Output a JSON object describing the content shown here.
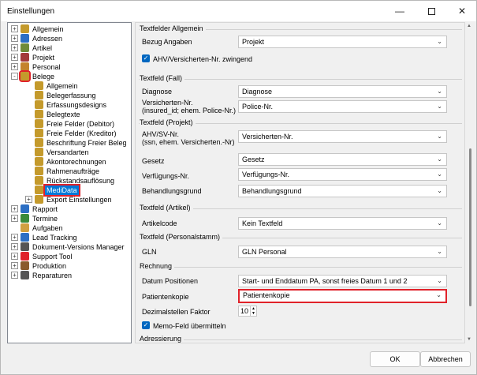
{
  "window": {
    "title": "Einstellungen"
  },
  "tree": {
    "items": [
      {
        "label": "Allgemein",
        "icon": "settings-folder-icon"
      },
      {
        "label": "Adressen",
        "icon": "address-book-icon"
      },
      {
        "label": "Artikel",
        "icon": "article-icon"
      },
      {
        "label": "Projekt",
        "icon": "project-icon"
      },
      {
        "label": "Personal",
        "icon": "personnel-icon"
      },
      {
        "label": "Belege",
        "icon": "documents-icon"
      },
      {
        "label": "Allgemein",
        "icon": "settings-icon"
      },
      {
        "label": "Belegerfassung",
        "icon": "settings-icon"
      },
      {
        "label": "Erfassungsdesigns",
        "icon": "settings-icon"
      },
      {
        "label": "Belegtexte",
        "icon": "settings-icon"
      },
      {
        "label": "Freie Felder (Debitor)",
        "icon": "settings-icon"
      },
      {
        "label": "Freie Felder (Kreditor)",
        "icon": "settings-icon"
      },
      {
        "label": "Beschriftung Freier Beleg",
        "icon": "settings-icon"
      },
      {
        "label": "Versandarten",
        "icon": "settings-icon"
      },
      {
        "label": "Akontorechnungen",
        "icon": "settings-icon"
      },
      {
        "label": "Rahmenaufträge",
        "icon": "settings-icon"
      },
      {
        "label": "Rückstandsauflösung",
        "icon": "settings-icon"
      },
      {
        "label": "MediData",
        "icon": "settings-icon"
      },
      {
        "label": "Export Einstellungen",
        "icon": "settings-icon"
      },
      {
        "label": "Rapport",
        "icon": "report-icon"
      },
      {
        "label": "Termine",
        "icon": "calendar-icon"
      },
      {
        "label": "Aufgaben",
        "icon": "tasks-icon"
      },
      {
        "label": "Lead Tracking",
        "icon": "lead-tracking-icon"
      },
      {
        "label": "Dokument-Versions Manager",
        "icon": "document-version-icon"
      },
      {
        "label": "Support Tool",
        "icon": "support-cross-icon"
      },
      {
        "label": "Produktion",
        "icon": "production-icon"
      },
      {
        "label": "Reparaturen",
        "icon": "repair-icon"
      }
    ]
  },
  "sections": {
    "allgemein": {
      "title": "Textfelder Allgemein",
      "bezug_label": "Bezug Angaben",
      "bezug_value": "Projekt",
      "ahv_check_label": "AHV/Versicherten-Nr. zwingend"
    },
    "fall": {
      "title": "Textfeld (Fall)",
      "diagnose_label": "Diagnose",
      "diagnose_value": "Diagnose",
      "versnr_label_1": "Versicherten-Nr.",
      "versnr_label_2": "(insured_id; ehem. Police-Nr.)",
      "versnr_value": "Police-Nr."
    },
    "projekt": {
      "title": "Textfeld (Projekt)",
      "ahv_label_1": "AHV/SV-Nr.",
      "ahv_label_2": "(ssn, ehem. Versicherten.-Nr)",
      "ahv_value": "Versicherten-Nr.",
      "gesetz_label": "Gesetz",
      "gesetz_value": "Gesetz",
      "verf_label": "Verfügungs-Nr.",
      "verf_value": "Verfügungs-Nr.",
      "behandlung_label": "Behandlungsgrund",
      "behandlung_value": "Behandlungsgrund"
    },
    "artikel": {
      "title": "Textfeld (Artikel)",
      "code_label": "Artikelcode",
      "code_value": "Kein Textfeld"
    },
    "personal": {
      "title": "Textfeld (Personalstamm)",
      "gln_label": "GLN",
      "gln_value": "GLN Personal"
    },
    "rechnung": {
      "title": "Rechnung",
      "datum_label": "Datum Positionen",
      "datum_value": "Start- und Enddatum PA, sonst freies Datum 1 und 2",
      "kopie_label": "Patientenkopie",
      "kopie_value": "Patientenkopie",
      "dezimal_label": "Dezimalstellen Faktor",
      "dezimal_value": "10",
      "memo_label": "Memo-Feld übermitteln"
    },
    "adressierung": {
      "title": "Adressierung"
    }
  },
  "buttons": {
    "ok": "OK",
    "cancel": "Abbrechen"
  },
  "colors": {
    "accent": "#0078d7",
    "highlight": "#e0222a",
    "checkbox": "#0067c0"
  }
}
